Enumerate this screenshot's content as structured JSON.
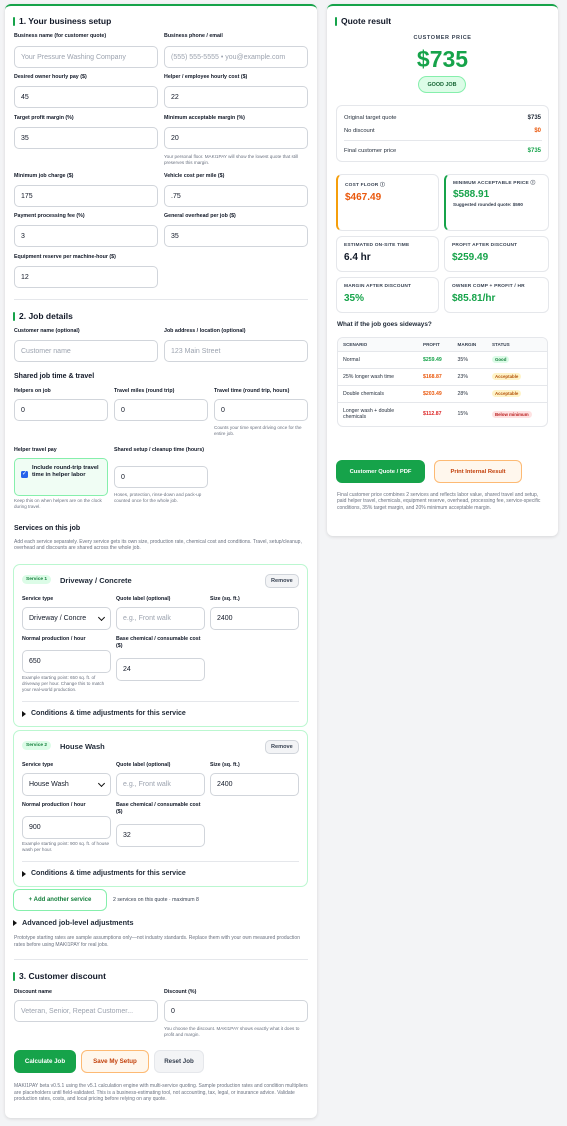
{
  "setup": {
    "title": "1. Your business setup",
    "business_name": {
      "label": "Business name (for customer quote)",
      "placeholder": "Your Pressure Washing Company"
    },
    "business_phone": {
      "label": "Business phone / email",
      "placeholder": "(555) 555-5555 • you@example.com"
    },
    "owner_pay": {
      "label": "Desired owner hourly pay ($)",
      "value": "45"
    },
    "helper_cost": {
      "label": "Helper / employee hourly cost ($)",
      "value": "22"
    },
    "target_margin": {
      "label": "Target profit margin (%)",
      "value": "35"
    },
    "min_margin": {
      "label": "Minimum acceptable margin (%)",
      "value": "20",
      "help": "Your personal floor. MAKI1PAY will show the lowest quote that still preserves this margin."
    },
    "min_charge": {
      "label": "Minimum job charge ($)",
      "value": "175"
    },
    "vehicle_cost": {
      "label": "Vehicle cost per mile ($)",
      "value": ".75"
    },
    "processing_fee": {
      "label": "Payment processing fee (%)",
      "value": "3"
    },
    "overhead": {
      "label": "General overhead per job ($)",
      "value": "35"
    },
    "equipment_reserve": {
      "label": "Equipment reserve per machine-hour ($)",
      "value": "12"
    }
  },
  "job": {
    "title": "2. Job details",
    "customer_name": {
      "label": "Customer name (optional)",
      "placeholder": "Customer name"
    },
    "job_address": {
      "label": "Job address / location (optional)",
      "placeholder": "123 Main Street"
    },
    "travel_title": "Shared job time & travel",
    "helpers": {
      "label": "Helpers on job",
      "value": "0"
    },
    "travel_miles": {
      "label": "Travel miles (round trip)",
      "value": "0"
    },
    "travel_time": {
      "label": "Travel time (round trip, hours)",
      "value": "0",
      "help": "Counts your time spent driving once for the entire job."
    },
    "helper_travel": {
      "label": "Helper travel pay",
      "checkbox_label": "Include round-trip travel time in helper labor",
      "help": "Keep this on when helpers are on the clock during travel."
    },
    "setup_cleanup": {
      "label": "Shared setup / cleanup time (hours)",
      "value": "0",
      "help": "Hoses, protection, rinse-down and pack-up counted once for the whole job."
    },
    "services_title": "Services on this job",
    "services_help": "Add each service separately. Every service gets its own size, production rate, chemical cost and conditions. Travel, setup/cleanup, overhead and discounts are shared across the whole job.",
    "services": [
      {
        "badge": "Service 1",
        "name": "Driveway / Concrete",
        "remove": "Remove",
        "type_label": "Service type",
        "type_value": "Driveway / Concre",
        "quote_label": "Quote label (optional)",
        "quote_placeholder": "e.g., Front walk",
        "size_label": "Size (sq. ft.)",
        "size_value": "2400",
        "prod_label": "Normal production / hour",
        "prod_value": "650",
        "prod_help": "Example starting point: 650 sq. ft. of driveway per hour. Change this to match your real-world production.",
        "chem_label": "Base chemical / consumable cost ($)",
        "chem_value": "24",
        "conditions": "Conditions & time adjustments for this service"
      },
      {
        "badge": "Service 2",
        "name": "House Wash",
        "remove": "Remove",
        "type_label": "Service type",
        "type_value": "House Wash",
        "quote_label": "Quote label (optional)",
        "quote_placeholder": "e.g., Front walk",
        "size_label": "Size (sq. ft.)",
        "size_value": "2400",
        "prod_label": "Normal production / hour",
        "prod_value": "900",
        "prod_help": "Example starting point: 900 sq. ft. of house wash per hour.",
        "chem_label": "Base chemical / consumable cost ($)",
        "chem_value": "32",
        "conditions": "Conditions & time adjustments for this service"
      }
    ],
    "add_service": "+ Add another service",
    "service_count": "2 services on this quote · maximum 8",
    "advanced": "Advanced job-level adjustments",
    "advanced_help": "Prototype starting rates are sample assumptions only—not industry standards. Replace them with your own measured production rates before using MAKI1PAY for real jobs."
  },
  "discount": {
    "title": "3. Customer discount",
    "name": {
      "label": "Discount name",
      "placeholder": "Veteran, Senior, Repeat Customer..."
    },
    "percent": {
      "label": "Discount (%)",
      "value": "0",
      "help": "You choose the discount. MAKI1PAY shows exactly what it does to profit and margin."
    }
  },
  "actions": {
    "calculate": "Calculate Job",
    "save": "Save My Setup",
    "reset": "Reset Job"
  },
  "footer": "MAKI1PAY beta v0.5.1 using the v5.1 calculation engine with multi-service quoting. Sample production rates and condition multipliers are placeholders until field-validated. This is a business-estimating tool, not accounting, tax, legal, or insurance advice. Validate production rates, costs, and local pricing before relying on any quote.",
  "result": {
    "title": "Quote result",
    "price_label": "CUSTOMER PRICE",
    "price": "$735",
    "verdict": "GOOD JOB",
    "summary": [
      {
        "label": "Original target quote",
        "value": "$735"
      },
      {
        "label": "No discount",
        "value": "$0"
      },
      {
        "label": "Final customer price",
        "value": "$735"
      }
    ],
    "cards": [
      {
        "label": "COST FLOOR ⓘ",
        "value": "$467.49",
        "note": ""
      },
      {
        "label": "MINIMUM ACCEPTABLE PRICE ⓘ",
        "value": "$588.91",
        "note": "Suggested rounded quote: $590"
      },
      {
        "label": "ESTIMATED ON-SITE TIME",
        "value": "6.4 hr",
        "note": ""
      },
      {
        "label": "PROFIT AFTER DISCOUNT",
        "value": "$259.49",
        "note": ""
      },
      {
        "label": "MARGIN AFTER DISCOUNT",
        "value": "35%",
        "note": ""
      },
      {
        "label": "OWNER COMP + PROFIT / HR",
        "value": "$85.81/hr",
        "note": ""
      }
    ],
    "sideways_title": "What if the job goes sideways?",
    "table_headers": [
      "SCENARIO",
      "PROFIT",
      "MARGIN",
      "STATUS"
    ],
    "scenarios": [
      {
        "scenario": "Normal",
        "profit": "$259.49",
        "margin": "35%",
        "status": "Good"
      },
      {
        "scenario": "25% longer wash time",
        "profit": "$168.87",
        "margin": "23%",
        "status": "Acceptable"
      },
      {
        "scenario": "Double chemicals",
        "profit": "$203.49",
        "margin": "28%",
        "status": "Acceptable"
      },
      {
        "scenario": "Longer wash + double chemicals",
        "profit": "$112.87",
        "margin": "15%",
        "status": "Below minimum"
      }
    ],
    "customer_pdf": "Customer Quote / PDF",
    "internal_result": "Print Internal Result",
    "note": "Final customer price combines 2 services and reflects labor value, shared travel and setup, paid helper travel, chemicals, equipment reserve, overhead, processing fee, service-specific conditions, 35% target margin, and 20% minimum acceptable margin."
  }
}
